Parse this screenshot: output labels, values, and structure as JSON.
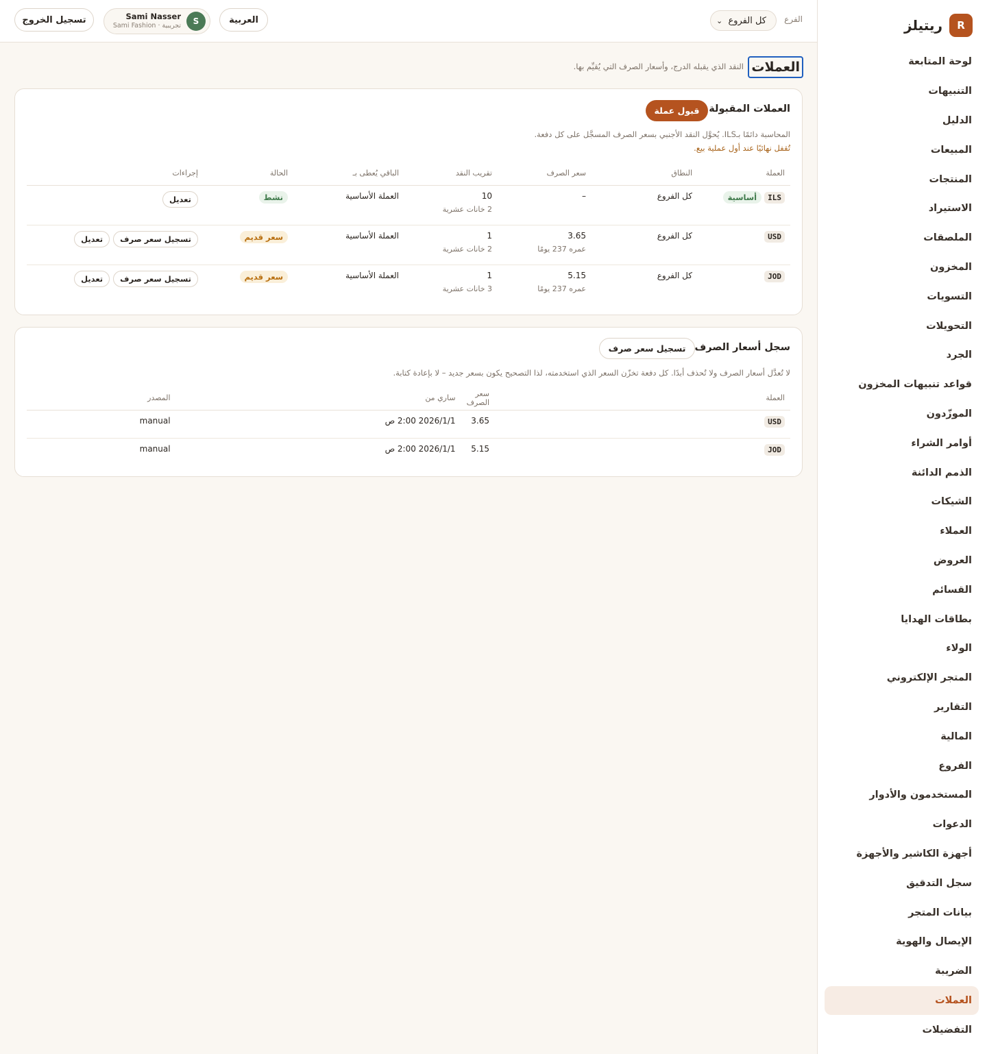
{
  "brand": {
    "badge": "R",
    "name": "ريتيلز"
  },
  "nav": [
    "لوحة المتابعة",
    "التنبيهات",
    "الدليل",
    "المبيعات",
    "المنتجات",
    "الاستيراد",
    "الملصقات",
    "المخزون",
    "التسويات",
    "التحويلات",
    "الجرد",
    "قواعد تنبيهات المخزون",
    "الموزّدون",
    "أوامر الشراء",
    "الذمم الدائنة",
    "الشيكات",
    "العملاء",
    "العروض",
    "القسائم",
    "بطاقات الهدايا",
    "الولاء",
    "المتجر الإلكتروني",
    "التقارير",
    "المالية",
    "الفروع",
    "المستخدمون والأدوار",
    "الدعوات",
    "أجهزة الكاشير والأجهزة",
    "سجل التدقيق",
    "بيانات المتجر",
    "الإيصال والهوية",
    "الضريبة",
    "العملات",
    "التفضيلات"
  ],
  "nav_active_index": 32,
  "topbar": {
    "branch_label": "الفرع",
    "branch_value": "كل الفروع",
    "language_button": "العربية",
    "user_name": "Sami Nasser",
    "user_org": "Sami Fashion · تجريبية",
    "user_initial": "S",
    "logout_button": "تسجيل الخروج"
  },
  "page": {
    "title": "العملات",
    "subtitle": "النقد الذي يقبله الدرج، وأسعار الصرف التي يُقيِّم بها."
  },
  "accepted": {
    "title": "العملات المقبولة",
    "accept_button": "قبول عملة",
    "note": "المحاسبة دائمًا بـILS. يُحوَّل النقد الأجنبي بسعر الصرف المسجَّل على كل دفعة.",
    "warning": "تُقفل نهائيًا عند أول عملية بيع.",
    "columns": [
      "العملة",
      "النطاق",
      "سعر الصرف",
      "تقريب النقد",
      "الباقي يُعطى بـ",
      "الحالة",
      "إجراءات"
    ],
    "rows": [
      {
        "code": "ILS",
        "base_badge": "أساسية",
        "scope": "كل الفروع",
        "rate": "–",
        "rate_age": "",
        "rounding": "10",
        "decimals": "2 خانات عشرية",
        "change_in": "العملة الأساسية",
        "status": "نشط",
        "status_kind": "active",
        "log_button": "",
        "edit_button": "تعديل"
      },
      {
        "code": "USD",
        "base_badge": "",
        "scope": "كل الفروع",
        "rate": "3.65",
        "rate_age": "عمره 237 يومًا",
        "rounding": "1",
        "decimals": "2 خانات عشرية",
        "change_in": "العملة الأساسية",
        "status": "سعر قديم",
        "status_kind": "old",
        "log_button": "تسجيل سعر صرف",
        "edit_button": "تعديل"
      },
      {
        "code": "JOD",
        "base_badge": "",
        "scope": "كل الفروع",
        "rate": "5.15",
        "rate_age": "عمره 237 يومًا",
        "rounding": "1",
        "decimals": "3 خانات عشرية",
        "change_in": "العملة الأساسية",
        "status": "سعر قديم",
        "status_kind": "old",
        "log_button": "تسجيل سعر صرف",
        "edit_button": "تعديل"
      }
    ]
  },
  "history": {
    "title": "سجل أسعار الصرف",
    "log_button": "تسجيل سعر صرف",
    "note": "لا تُعدَّل أسعار الصرف ولا تُحذف أبدًا. كل دفعة تخزّن السعر الذي استخدمته، لذا التصحيح يكون بسعر جديد – لا بإعادة كتابة.",
    "columns": [
      "العملة",
      "سعر الصرف",
      "ساري من",
      "المصدر"
    ],
    "rows": [
      {
        "code": "USD",
        "rate": "3.65",
        "effective": "2026/1/1 2:00 ص",
        "source": "manual"
      },
      {
        "code": "JOD",
        "rate": "5.15",
        "effective": "2026/1/1 2:00 ص",
        "source": "manual"
      }
    ]
  },
  "colors": {
    "accent": "#b5531f",
    "active_green": "#3f7a4b",
    "stale_amber": "#b86f10",
    "focus_blue": "#1f5fbf"
  },
  "icons": {
    "branch_select": "chevron-down-icon"
  }
}
